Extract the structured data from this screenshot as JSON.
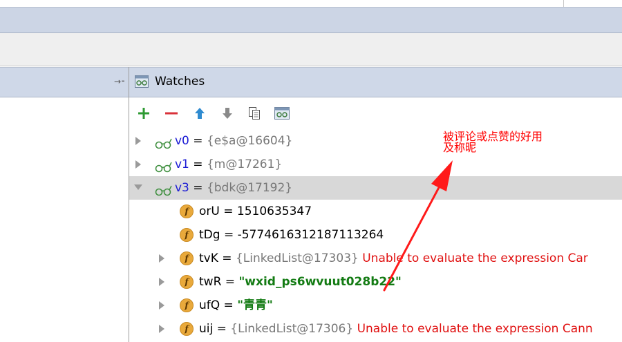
{
  "watches_panel": {
    "title": "Watches"
  },
  "toolbar": {
    "add_icon": "plus-icon",
    "remove_icon": "minus-icon",
    "up_icon": "arrow-up-icon",
    "down_icon": "arrow-down-icon",
    "copy_icon": "copy-icon",
    "watch_icon": "glasses-icon"
  },
  "watches": [
    {
      "name": "v0",
      "eq": " = ",
      "value": "{e$a@16604}"
    },
    {
      "name": "v1",
      "eq": " = ",
      "value": "{m@17261}"
    },
    {
      "name": "v3",
      "eq": " = ",
      "value": "{bdk@17192}"
    }
  ],
  "fields": [
    {
      "name": "orU",
      "eq": " = ",
      "value": "1510635347"
    },
    {
      "name": "tDg",
      "eq": " = ",
      "value": "-5774616312187113264"
    },
    {
      "name": "tvK",
      "eq": " = ",
      "value": "{LinkedList@17303}",
      "error": " Unable to evaluate the expression Car"
    },
    {
      "name": "twR",
      "eq": " = ",
      "value": "\"wxid_ps6wvuut028b22\""
    },
    {
      "name": "ufQ",
      "eq": " = ",
      "value": "\"青青\""
    },
    {
      "name": "uij",
      "eq": " = ",
      "value": "{LinkedList@17306}",
      "error": " Unable to evaluate the expression Cann"
    }
  ],
  "annotation": {
    "line1": "被评论或点赞的好用",
    "line2": "及称昵",
    "color": "#ff0000"
  },
  "colors": {
    "header": "#cfd8e8",
    "selection": "#d8d8d8",
    "string_value": "#137b13",
    "error": "#e01010",
    "watch_name": "#1a1ad4"
  }
}
